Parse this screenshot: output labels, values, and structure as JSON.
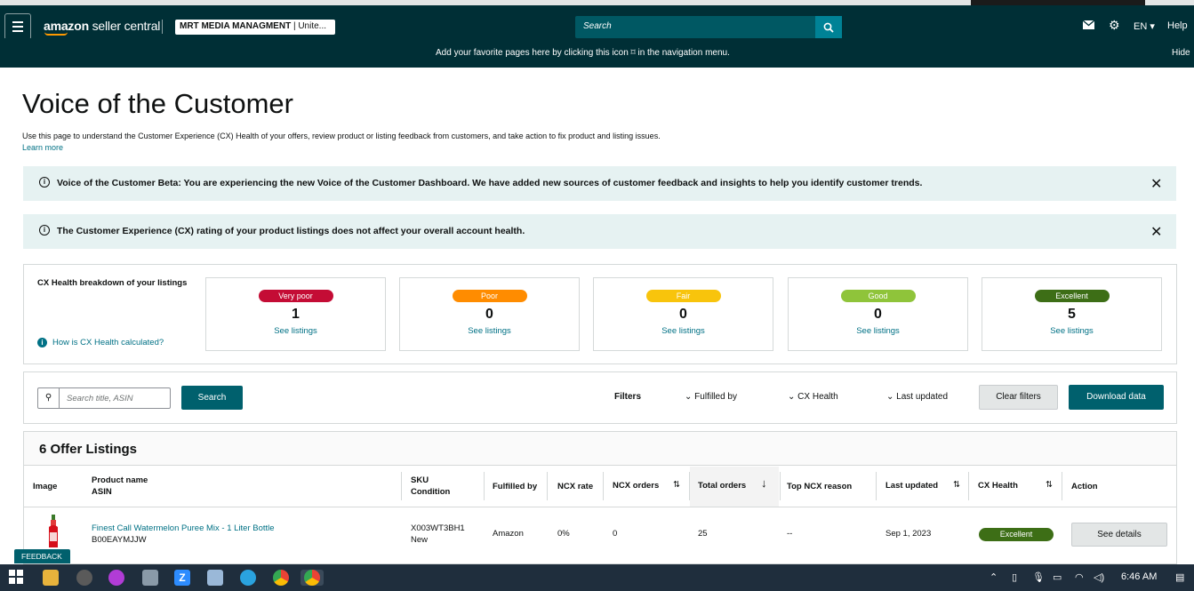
{
  "topbar": {
    "logo_main": "amazon",
    "logo_sub": " seller central",
    "store_name": "MRT MEDIA MANAGMENT",
    "store_region": " | Unite...",
    "search_placeholder": "Search",
    "language": "EN",
    "help": "Help"
  },
  "favbar": {
    "message": "Add your favorite pages here by clicking this icon ⌑ in the navigation menu.",
    "hide": "Hide"
  },
  "page": {
    "title": "Voice of the Customer",
    "description": "Use this page to understand the Customer Experience (CX) Health of your offers, review product or listing feedback from customers, and take action to fix product and listing issues.",
    "learn_more": "Learn more"
  },
  "banners": [
    {
      "text": "Voice of the Customer Beta: You are experiencing the new Voice of the Customer Dashboard. We have added new sources of customer feedback and insights to help you identify customer trends."
    },
    {
      "text": "The Customer Experience (CX) rating of your product listings does not affect your overall account health."
    }
  ],
  "breakdown": {
    "title": "CX Health breakdown of your listings",
    "how_link": "How is CX Health calculated?",
    "cards": [
      {
        "label": "Very poor",
        "count": "1",
        "link": "See listings",
        "color": "#c40c35"
      },
      {
        "label": "Poor",
        "count": "0",
        "link": "See listings",
        "color": "#ff8c00"
      },
      {
        "label": "Fair",
        "count": "0",
        "link": "See listings",
        "color": "#f8c40c"
      },
      {
        "label": "Good",
        "count": "0",
        "link": "See listings",
        "color": "#8fc43a"
      },
      {
        "label": "Excellent",
        "count": "5",
        "link": "See listings",
        "color": "#3d6e16"
      }
    ]
  },
  "toolbar": {
    "search_placeholder": "Search title, ASIN",
    "search_button": "Search",
    "filters_label": "Filters",
    "filter_fulfilled": "Fulfilled by",
    "filter_cx": "CX Health",
    "filter_updated": "Last updated",
    "clear_filters": "Clear filters",
    "download": "Download data"
  },
  "listing": {
    "heading": "6 Offer Listings",
    "columns": {
      "image": "Image",
      "product_name": "Product name",
      "asin": "ASIN",
      "sku": "SKU",
      "condition": "Condition",
      "fulfilled_by": "Fulfilled by",
      "ncx_rate": "NCX rate",
      "ncx_orders": "NCX orders",
      "total_orders": "Total orders",
      "top_ncx_reason": "Top NCX reason",
      "last_updated": "Last updated",
      "cx_health": "CX Health",
      "action": "Action"
    },
    "rows": [
      {
        "product_name": "Finest Call Watermelon Puree Mix - 1 Liter Bottle",
        "asin": "B00EAYMJJW",
        "sku": "X003WT3BH1",
        "condition": "New",
        "fulfilled_by": "Amazon",
        "ncx_rate": "0%",
        "ncx_orders": "0",
        "total_orders": "25",
        "top_ncx_reason": "--",
        "last_updated": "Sep 1, 2023",
        "cx_health": "Excellent",
        "action": "See details"
      }
    ]
  },
  "feedback": "FEEDBACK ✕",
  "taskbar": {
    "time": "6:46 AM"
  }
}
